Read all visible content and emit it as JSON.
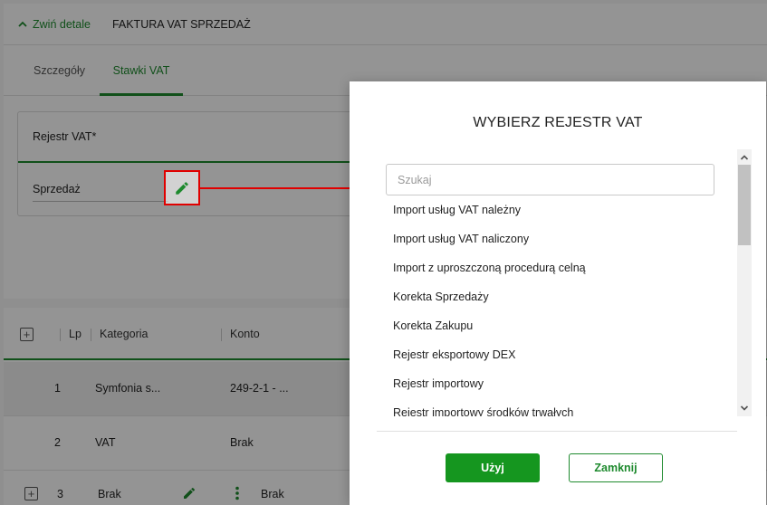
{
  "header": {
    "collapse_label": "Zwiń detale",
    "doc_title": "FAKTURA VAT SPRZEDAŻ"
  },
  "tabs": [
    {
      "label": "Szczegóły"
    },
    {
      "label": "Stawki VAT"
    }
  ],
  "vat_register": {
    "label": "Rejestr VAT*",
    "value": "Sprzedaż"
  },
  "table": {
    "headers": {
      "lp": "Lp",
      "category": "Kategoria",
      "account": "Konto"
    },
    "rows": [
      {
        "lp": "1",
        "category": "Symfonia s...",
        "account": "249-2-1 - ..."
      },
      {
        "lp": "2",
        "category": "VAT",
        "account": "Brak"
      },
      {
        "lp": "3",
        "category": "Brak",
        "account": "Brak"
      }
    ]
  },
  "modal": {
    "title": "WYBIERZ REJESTR VAT",
    "search_placeholder": "Szukaj",
    "items": [
      "Import usług VAT należny",
      "Import usług VAT naliczony",
      "Import z uproszczoną procedurą celną",
      "Korekta Sprzedaży",
      "Korekta Zakupu",
      "Rejestr eksportowy DEX",
      "Rejestr importowy",
      "Rejestr importowy środków trwałych"
    ],
    "use_label": "Użyj",
    "close_label": "Zamknij"
  },
  "colors": {
    "accent": "#1e8a2e",
    "primary_button": "#15961f",
    "annotation": "#e00000"
  }
}
